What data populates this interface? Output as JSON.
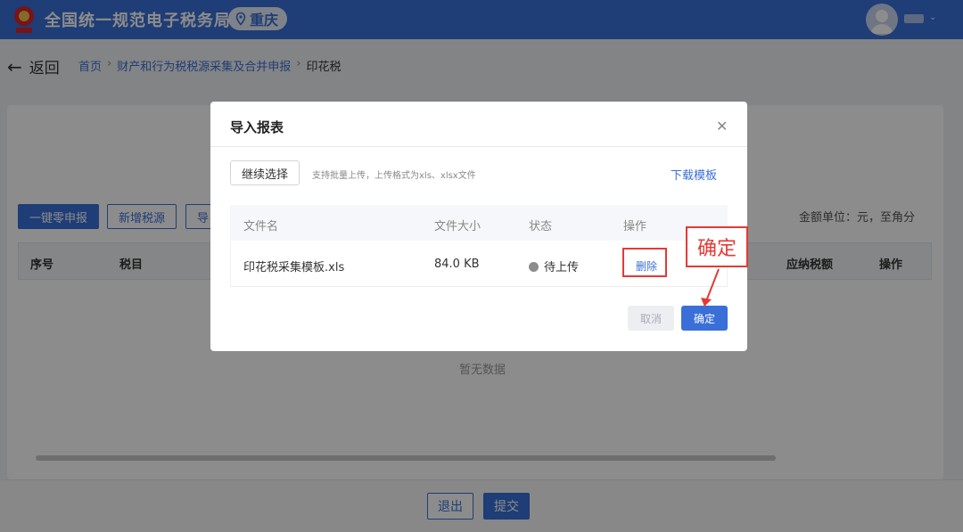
{
  "header": {
    "app_title": "全国统一规范电子税务局",
    "region": "重庆",
    "emblem_icon": "tax-emblem-icon",
    "brand_color": "#3a6fd8"
  },
  "breadcrumb": {
    "back_label": "返回",
    "items": [
      "首页",
      "财产和行为税税源采集及合并申报",
      "印花税"
    ]
  },
  "toolbar": {
    "zero_declare": "一键零申报",
    "add_source": "新增税源",
    "import_partial": "导",
    "unit_note": "金额单位：元，至角分"
  },
  "main_table": {
    "headers": [
      "序号",
      "税目",
      "应纳税额",
      "操作"
    ],
    "empty_text": "暂无数据"
  },
  "footer": {
    "exit": "退出",
    "submit": "提交"
  },
  "modal": {
    "title": "导入报表",
    "close_icon": "close-icon",
    "choose_button": "继续选择",
    "hint": "支持批量上传，上传格式为xls、xlsx文件",
    "download_template": "下载模板",
    "file_table": {
      "headers": [
        "文件名",
        "文件大小",
        "状态",
        "操作"
      ],
      "rows": [
        {
          "name": "印花税采集模板.xls",
          "size": "84.0 KB",
          "status": "待上传",
          "action": "删除"
        }
      ]
    },
    "cancel_label": "取消",
    "confirm_label": "确定"
  },
  "annotation": {
    "callout_text": "确定",
    "highlight_color": "#e53935"
  }
}
